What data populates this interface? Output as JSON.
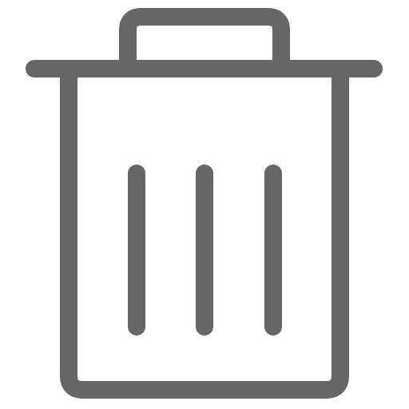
{
  "icon": {
    "name": "trash-icon",
    "color": "#666666",
    "background": "#ffffff"
  }
}
